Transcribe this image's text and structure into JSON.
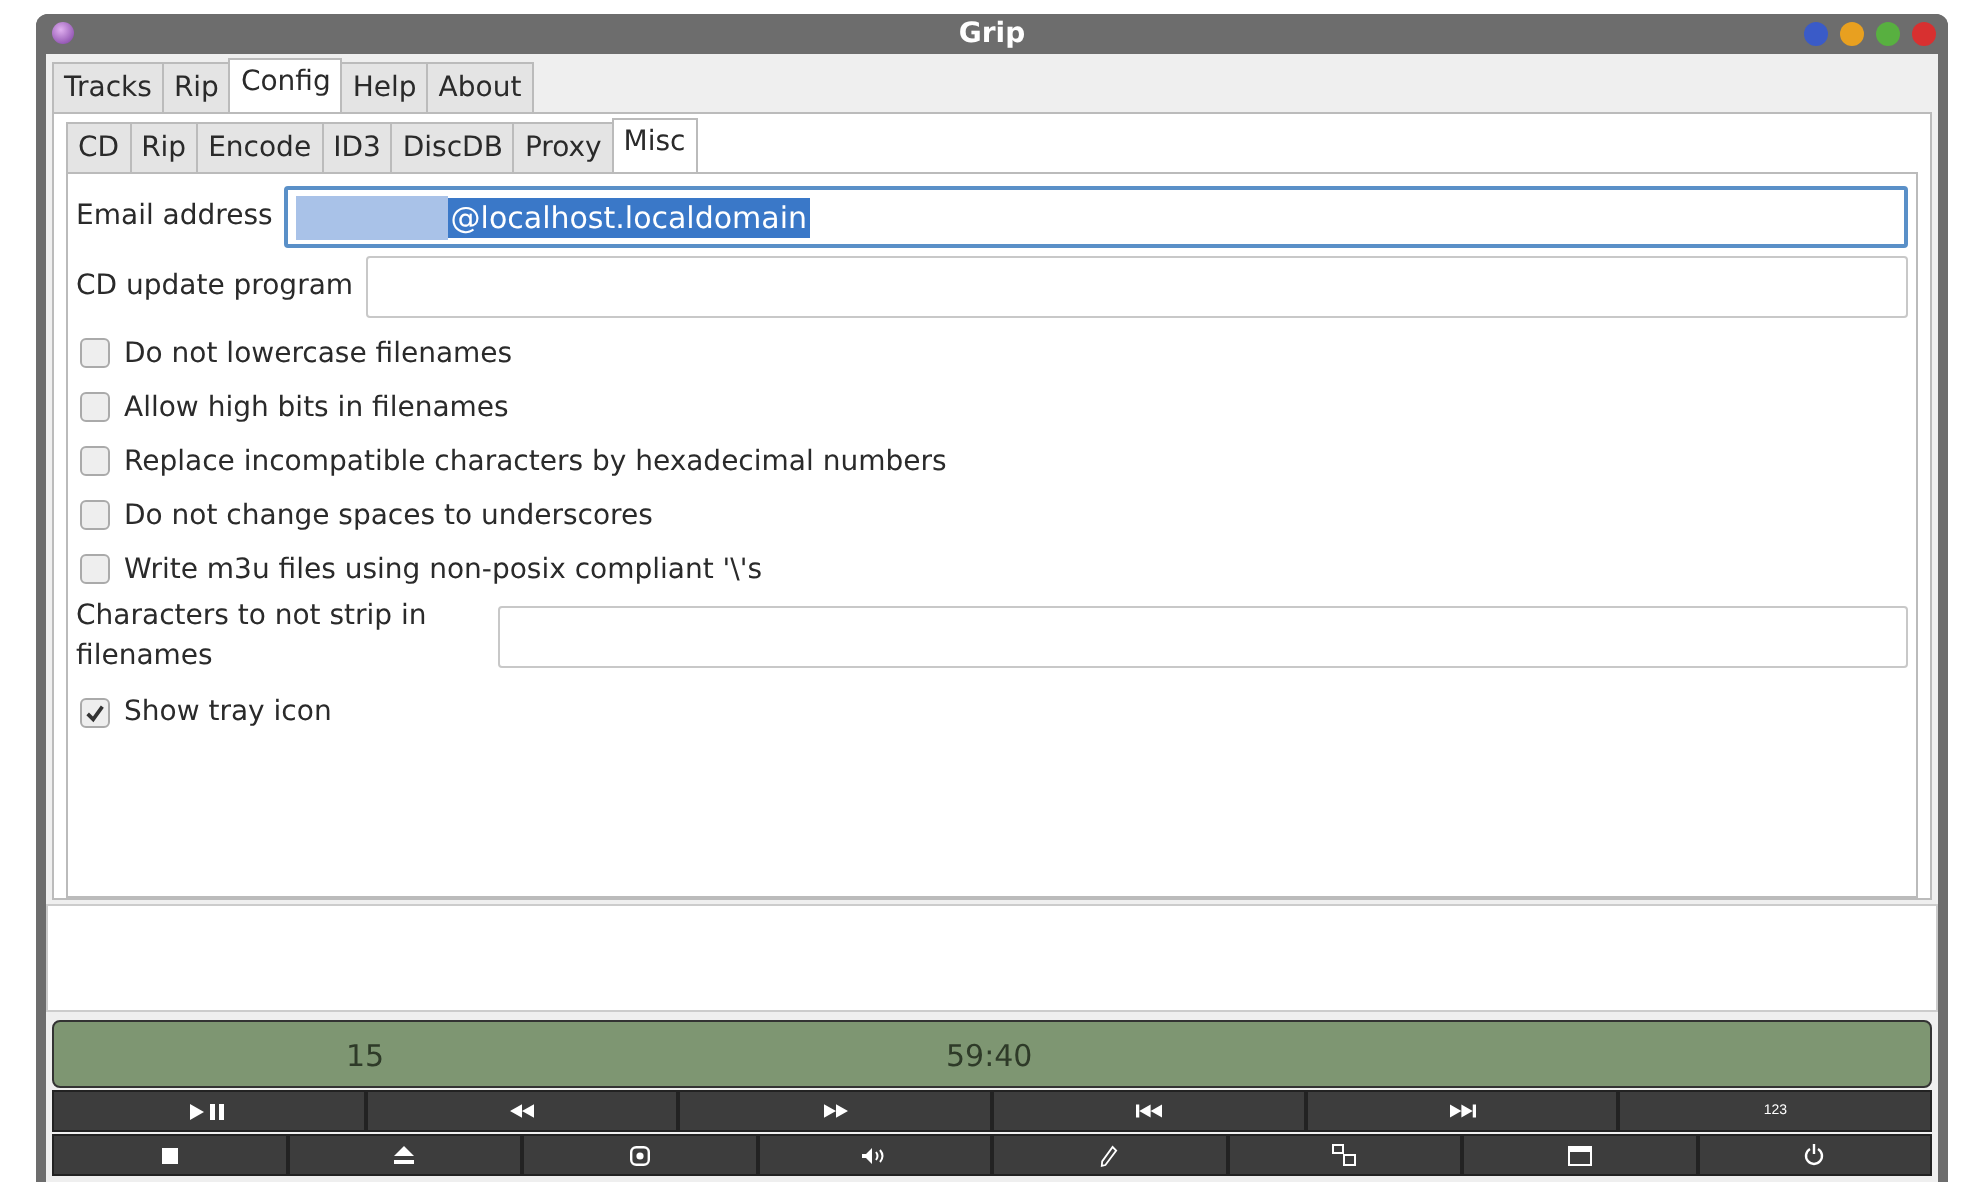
{
  "window": {
    "title": "Grip"
  },
  "tabs": [
    {
      "label": "Tracks",
      "selected": false
    },
    {
      "label": "Rip",
      "selected": false
    },
    {
      "label": "Config",
      "selected": true
    },
    {
      "label": "Help",
      "selected": false
    },
    {
      "label": "About",
      "selected": false
    }
  ],
  "subtabs": [
    {
      "label": "CD",
      "selected": false
    },
    {
      "label": "Rip",
      "selected": false
    },
    {
      "label": "Encode",
      "selected": false
    },
    {
      "label": "ID3",
      "selected": false
    },
    {
      "label": "DiscDB",
      "selected": false
    },
    {
      "label": "Proxy",
      "selected": false
    },
    {
      "label": "Misc",
      "selected": true
    }
  ],
  "options": [
    {
      "kind": "field",
      "label": "Email address",
      "value": "@localhost.localdomain",
      "focused": true,
      "redacted": true
    },
    {
      "kind": "field",
      "label": "CD update program",
      "focused": false
    },
    {
      "kind": "checkbox",
      "label": "Do not lowercase filenames",
      "checked": false
    },
    {
      "kind": "checkbox",
      "label": "Allow high bits in filenames",
      "checked": false
    },
    {
      "kind": "checkbox",
      "label": "Replace incompatible characters by hexadecimal numbers",
      "checked": false
    },
    {
      "kind": "checkbox",
      "label": "Do not change spaces to underscores",
      "checked": false
    },
    {
      "kind": "checkbox",
      "label": "Write m3u files using non-posix compliant '\\'s",
      "checked": false
    },
    {
      "kind": "field",
      "label": "Characters to not strip in filenames",
      "focused": false
    },
    {
      "kind": "checkbox",
      "label": "Show tray icon",
      "checked": true
    }
  ],
  "display": {
    "track": "15",
    "time": "59:40"
  },
  "track_number_button": "123"
}
